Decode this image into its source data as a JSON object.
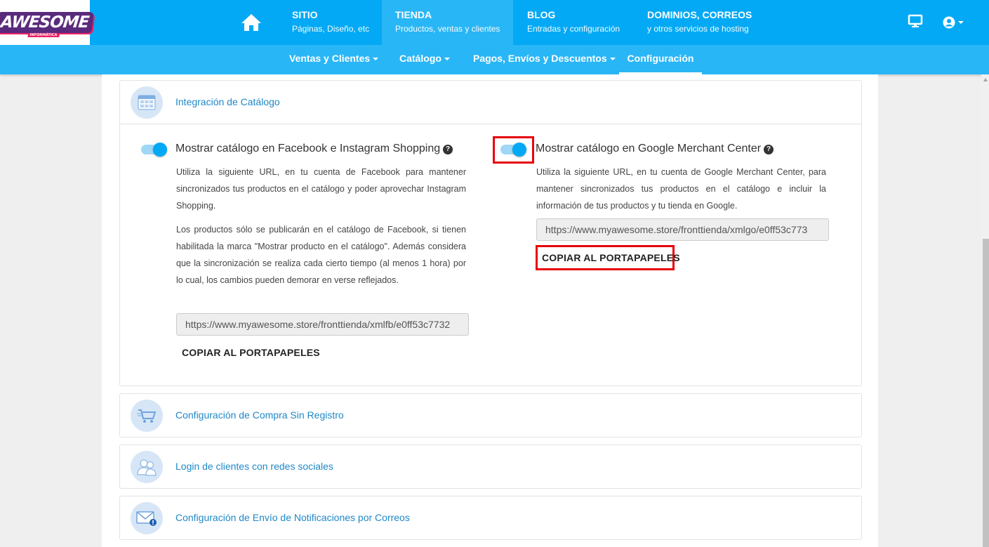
{
  "brand": {
    "logo_text": "AWESOME",
    "logo_sub": "INFORMÁTICA"
  },
  "topnav": {
    "home_icon": "home-icon",
    "tabs": [
      {
        "title": "SITIO",
        "subtitle": "Páginas, Diseño, etc"
      },
      {
        "title": "TIENDA",
        "subtitle": "Productos, ventas y clientes"
      },
      {
        "title": "BLOG",
        "subtitle": "Entradas y configuración"
      },
      {
        "title": "DOMINIOS, CORREOS",
        "subtitle": "y otros servicios de hosting"
      }
    ],
    "active_tab": "TIENDA",
    "right_icons": [
      "monitor-icon",
      "user-circle-icon"
    ]
  },
  "subnav": {
    "items": [
      "Ventas y Clientes",
      "Catálogo",
      "Pagos, Envíos y Descuentos",
      "Configuración"
    ],
    "active": "Configuración"
  },
  "panels": {
    "catalog": {
      "title": "Integración de Catálogo",
      "icon": "calendar-grid-icon",
      "facebook": {
        "enabled": true,
        "title": "Mostrar catálogo en Facebook e Instagram Shopping",
        "help": "?",
        "desc1": "Utiliza la siguiente URL, en tu cuenta de Facebook para mantener sincronizados tus productos en el catálogo y poder aprovechar Instagram Shopping.",
        "desc2": "Los productos sólo se publicarán en el catálogo de Facebook, si tienen habilitada la marca \"Mostrar producto en el catálogo\". Además considera que la sincronización se realiza cada cierto tiempo (al menos 1 hora) por lo cual, los cambios pueden demorar en verse reflejados.",
        "url": "https://www.myawesome.store/fronttienda/xmlfb/e0ff53c7732",
        "copy_label": "COPIAR AL PORTAPAPELES"
      },
      "google": {
        "enabled": true,
        "title": "Mostrar catálogo en Google Merchant Center",
        "help": "?",
        "desc": "Utiliza la siguiente URL, en tu cuenta de Google Merchant Center, para mantener sincronizados tus productos en el catálogo e incluir la información de tus productos y tu tienda en Google.",
        "url": "https://www.myawesome.store/fronttienda/xmlgo/e0ff53c773",
        "copy_label": "COPIAR AL PORTAPAPELES"
      }
    },
    "guest_checkout": {
      "title": "Configuración de Compra Sin Registro",
      "icon": "cart-icon"
    },
    "social_login": {
      "title": "Login de clientes con redes sociales",
      "icon": "users-icon"
    },
    "email_notifications": {
      "title": "Configuración de Envío de Notificaciones por Correos",
      "icon": "envelope-icon"
    }
  },
  "colors": {
    "primary": "#03a9f4",
    "subnav": "#29b6f6",
    "link": "#1e88c8",
    "highlight": "#e8000b"
  }
}
